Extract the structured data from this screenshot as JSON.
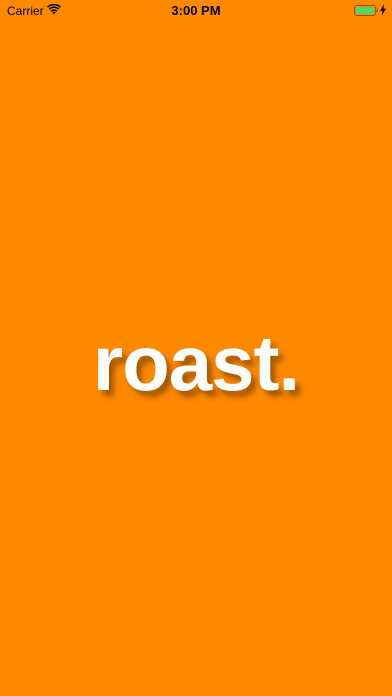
{
  "status_bar": {
    "carrier": "Carrier",
    "time": "3:00 PM",
    "icons": [
      "wifi-icon",
      "battery-icon",
      "charging-icon"
    ],
    "battery_level": 1.0,
    "battery_color": "#4CD964"
  },
  "splash": {
    "logo_text": "roast.",
    "background_color": "#FF8A00",
    "logo_color": "#FFFFFF"
  }
}
